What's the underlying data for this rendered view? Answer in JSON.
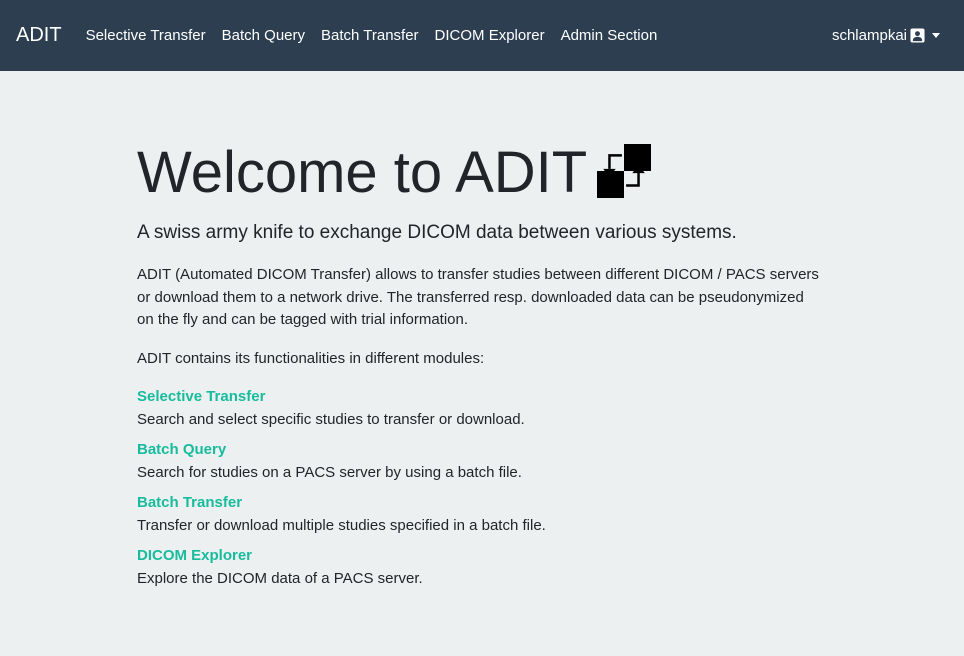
{
  "navbar": {
    "brand": "ADIT",
    "links": [
      "Selective Transfer",
      "Batch Query",
      "Batch Transfer",
      "DICOM Explorer",
      "Admin Section"
    ],
    "user": "schlampkai",
    "user_icon": "user-square-icon",
    "dropdown_icon": "caret-down-icon"
  },
  "main": {
    "title": "Welcome to ADIT",
    "title_icon": "transfer-arrows-icon",
    "lead": "A swiss army knife to exchange DICOM data between various systems.",
    "description": "ADIT (Automated DICOM Transfer) allows to transfer studies between different DICOM / PACS servers or download them to a network drive. The transferred resp. downloaded data can be pseudonymized on the fly and can be tagged with trial information.",
    "modules_intro": "ADIT contains its functionalities in different modules:",
    "modules": [
      {
        "title": "Selective Transfer",
        "description": "Search and select specific studies to transfer or download."
      },
      {
        "title": "Batch Query",
        "description": "Search for studies on a PACS server by using a batch file."
      },
      {
        "title": "Batch Transfer",
        "description": "Transfer or download multiple studies specified in a batch file."
      },
      {
        "title": "DICOM Explorer",
        "description": "Explore the DICOM data of a PACS server."
      }
    ]
  },
  "colors": {
    "navbar_bg": "#2c3e50",
    "page_bg": "#ecf0f1",
    "accent": "#18bc9c",
    "text": "#212529"
  }
}
